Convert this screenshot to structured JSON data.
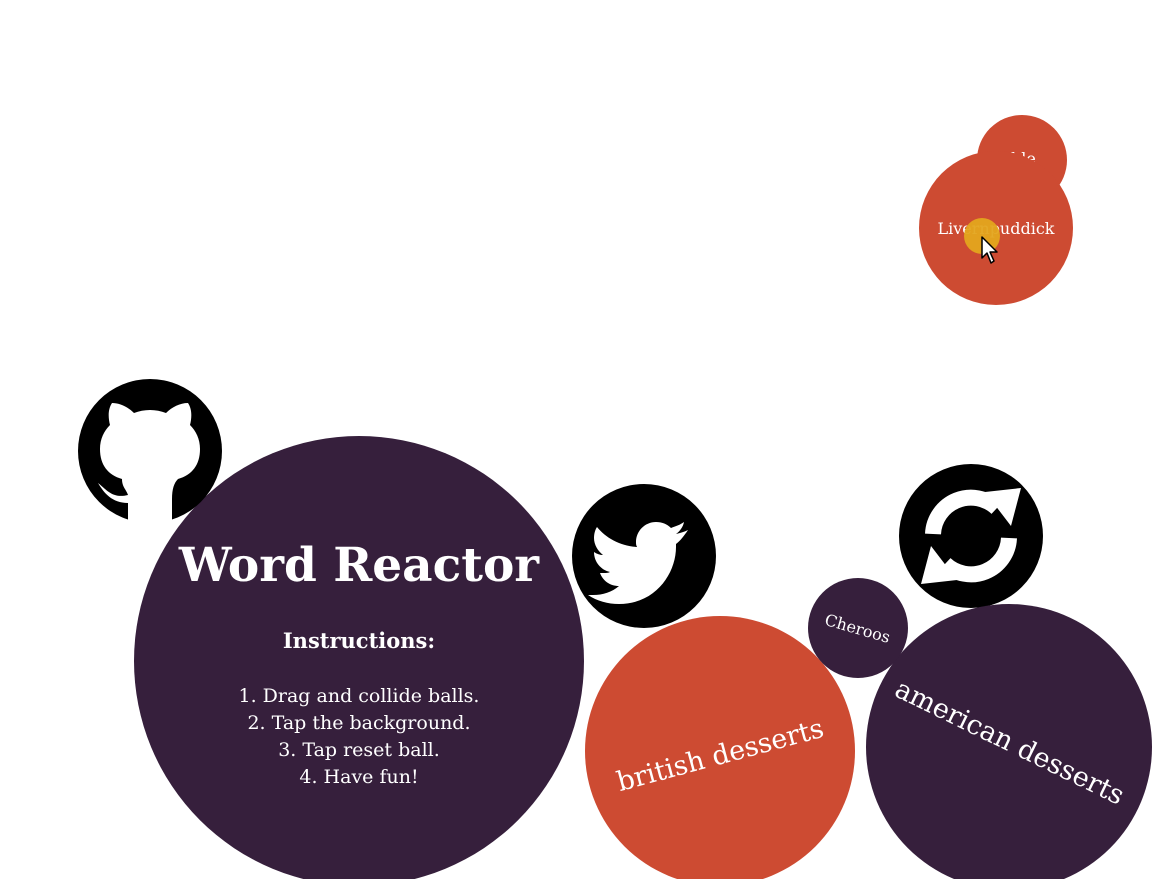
{
  "app": {
    "title": "Word Reactor",
    "instructions_heading": "Instructions:",
    "instructions": [
      "1. Drag and collide balls.",
      "2. Tap the background.",
      "3. Tap reset ball.",
      "4. Have fun!"
    ]
  },
  "balls": {
    "british": "british desserts",
    "american": "american desserts",
    "cheroos": "Cheroos",
    "small_top": "ble",
    "liver": "Livernpuddick"
  },
  "icons": {
    "github": "github-icon",
    "twitter": "twitter-icon",
    "reset": "refresh-icon",
    "cursor": "mouse-pointer-icon"
  },
  "colors": {
    "purple": "#361f3c",
    "orange": "#cd4b32",
    "black": "#000000",
    "touch": "#e3a51e"
  }
}
